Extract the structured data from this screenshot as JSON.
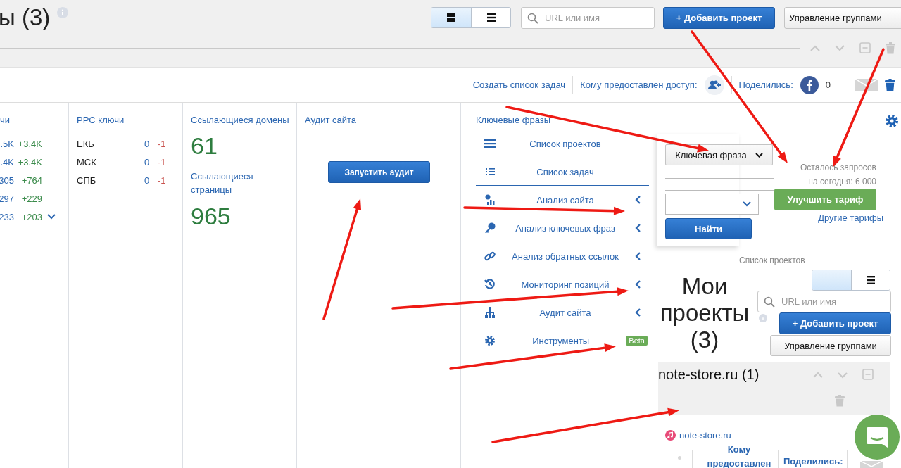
{
  "header": {
    "title": "ы (3)",
    "view_modes": [
      {
        "selected": true
      },
      {
        "selected": false
      }
    ],
    "search": {
      "placeholder": "URL или имя"
    },
    "add_button": "+ Добавить проект",
    "groups_button": "Управление группами"
  },
  "toolbar": {
    "create_tasks": "Создать список задач",
    "access_label": "Кому предоставлен доступ:",
    "shared_label": "Поделились:",
    "shared_count": "0"
  },
  "keywords": {
    "title": "чи",
    "rows": [
      {
        "value": ".5K",
        "delta": "+3.4K"
      },
      {
        "value": ".4K",
        "delta": "+3.4K"
      },
      {
        "value": "305",
        "delta": "+764"
      },
      {
        "value": "297",
        "delta": "+229"
      },
      {
        "value": "233",
        "delta": "+203"
      }
    ]
  },
  "ppc": {
    "title": "PPC ключи",
    "rows": [
      {
        "region": "ЕКБ",
        "value": "0",
        "delta": "-1"
      },
      {
        "region": "МСК",
        "value": "0",
        "delta": "-1"
      },
      {
        "region": "СПБ",
        "value": "0",
        "delta": "-1"
      }
    ]
  },
  "links": {
    "domains_title": "Ссылающиеся домены",
    "domains": "61",
    "pages_title": "Ссылающиеся страницы",
    "pages": "965"
  },
  "audit": {
    "title": "Аудит сайта",
    "button": "Запустить аудит"
  },
  "menu": {
    "title": "Ключевые фразы",
    "items": [
      {
        "label": "Список проектов",
        "kind": "link"
      },
      {
        "label": "Список задач",
        "kind": "link"
      },
      {
        "label": "Анализ сайта",
        "kind": "submenu"
      },
      {
        "label": "Анализ ключевых фраз",
        "kind": "submenu"
      },
      {
        "label": "Анализ обратных ссылок",
        "kind": "submenu"
      },
      {
        "label": "Мониторинг позиций",
        "kind": "submenu"
      },
      {
        "label": "Аудит сайта",
        "kind": "submenu"
      },
      {
        "label": "Инструменты",
        "kind": "badge",
        "badge": "Beta"
      }
    ]
  },
  "search_card": {
    "type_select": "Ключевая фраза",
    "find_button": "Найти"
  },
  "quota": {
    "text": "Осталось запросов на сегодня: 6 000",
    "upgrade_button": "Улучшить тариф",
    "other_plans": "Другие тарифы"
  },
  "projects": {
    "breadcrumb": "Список проектов",
    "title": "Мои проекты (3)",
    "view_modes": [
      {
        "selected": true
      },
      {
        "selected": false
      }
    ],
    "search": {
      "placeholder": "URL или имя"
    },
    "add_button": "+ Добавить проект",
    "groups_button": "Управление группами",
    "group_title": "note-store.ru (1)",
    "domain": "note-store.ru",
    "access_label": "Кому предоставлен",
    "shared_label": "Поделились:"
  }
}
